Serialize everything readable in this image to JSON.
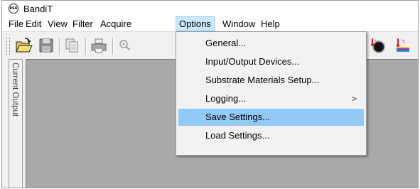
{
  "window": {
    "title": "BandiT",
    "icon": "ksa-logo-icon",
    "icon_text": "kSA"
  },
  "menubar": {
    "items": [
      {
        "label": "File"
      },
      {
        "label": "Edit"
      },
      {
        "label": "View"
      },
      {
        "label": "Filter"
      },
      {
        "label": "Acquire"
      },
      {
        "label": "Options",
        "active": true
      },
      {
        "label": "Window"
      },
      {
        "label": "Help"
      }
    ]
  },
  "toolbar": {
    "buttons": [
      "open-folder-icon",
      "save-disk-icon",
      "copy-icon",
      "print-icon",
      "zoom-icon",
      "temperature-dial-icon",
      "temperature-lamp-icon"
    ]
  },
  "side_panel": {
    "label": "Current Output"
  },
  "options_menu": {
    "items": [
      {
        "label": "General..."
      },
      {
        "label": "Input/Output Devices..."
      },
      {
        "label": "Substrate Materials Setup..."
      },
      {
        "label": "Logging...",
        "submenu_arrow": ">"
      },
      {
        "label": "Save Settings...",
        "highlighted": true
      },
      {
        "label": "Load Settings..."
      }
    ]
  },
  "colors": {
    "highlight": "#91c9f7",
    "active_menu": "#cce8ff",
    "client_area": "#a9a9a9"
  }
}
